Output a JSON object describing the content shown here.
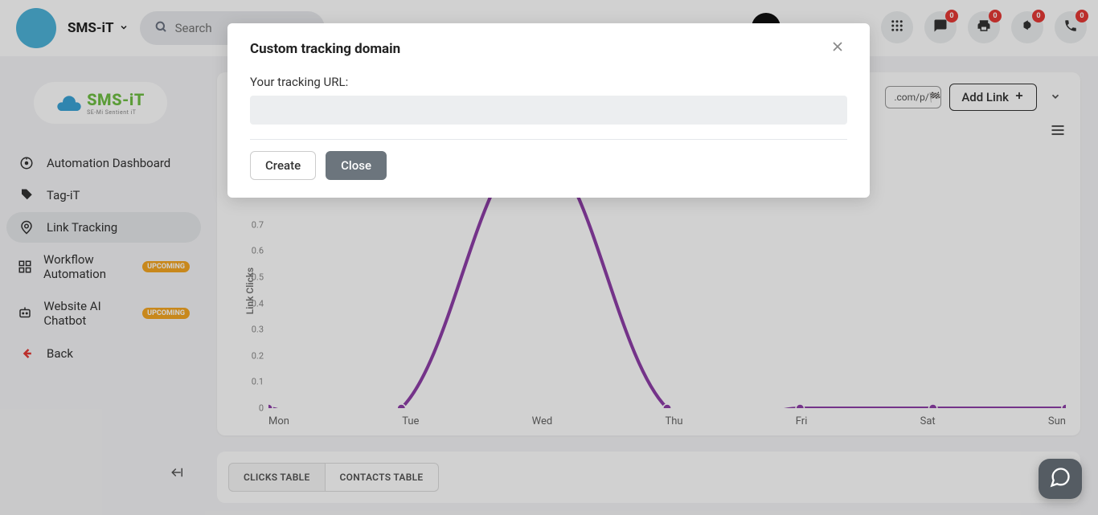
{
  "topbar": {
    "brand": "SMS-iT",
    "search_placeholder": "Search",
    "badges": {
      "chat": "0",
      "print": "0",
      "announce": "0",
      "phone": "0"
    }
  },
  "sidebar": {
    "logo_main": "SMS-",
    "logo_accent": "iT",
    "logo_sub": "SE-Mi Sentient iT",
    "items": [
      {
        "label": "Automation Dashboard",
        "active": false,
        "badge": ""
      },
      {
        "label": "Tag-iT",
        "active": false,
        "badge": ""
      },
      {
        "label": "Link Tracking",
        "active": true,
        "badge": ""
      },
      {
        "label": "Workflow Automation",
        "active": false,
        "badge": "UPCOMING"
      },
      {
        "label": "Website AI Chatbot",
        "active": false,
        "badge": "UPCOMING"
      },
      {
        "label": "Back",
        "active": false,
        "badge": "",
        "back": true
      }
    ]
  },
  "main": {
    "url_fragment": ".com/p/🏁",
    "add_link": "Add Link",
    "tabs": [
      {
        "label": "CLICKS TABLE",
        "active": true
      },
      {
        "label": "CONTACTS TABLE",
        "active": false
      }
    ]
  },
  "chart_data": {
    "type": "line",
    "ylabel": "Link Clicks",
    "categories": [
      "Mon",
      "Tue",
      "Wed",
      "Thu",
      "Fri",
      "Sat",
      "Sun"
    ],
    "values": [
      0,
      0,
      1,
      0,
      0,
      0,
      0
    ],
    "ylim": [
      0,
      1
    ],
    "y_ticks": [
      "0",
      "0.1",
      "0.2",
      "0.3",
      "0.4",
      "0.5",
      "0.6",
      "0.7"
    ],
    "color": "#8e3fa8"
  },
  "modal": {
    "title": "Custom tracking domain",
    "field_label": "Your tracking URL:",
    "create": "Create",
    "close": "Close"
  }
}
